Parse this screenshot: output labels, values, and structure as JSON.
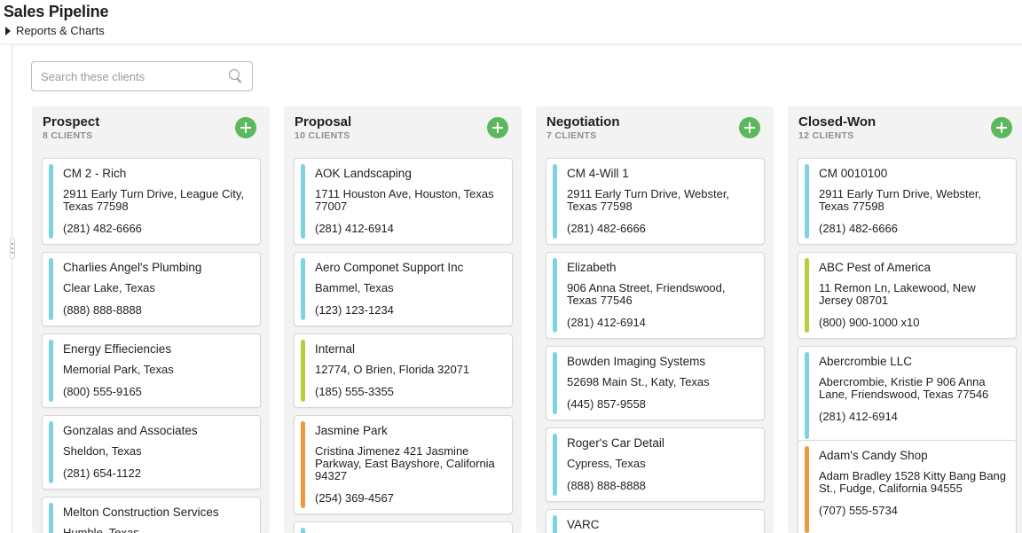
{
  "header": {
    "title": "Sales Pipeline",
    "reports_label": "Reports & Charts"
  },
  "search": {
    "placeholder": "Search these clients"
  },
  "colors": {
    "accent_add": "#5cb85c",
    "bar_blue": "#7dd3e0",
    "bar_green": "#b5cf3c",
    "bar_orange": "#ec9a3c"
  },
  "columns": [
    {
      "title": "Prospect",
      "count": "8 CLIENTS",
      "cards": [
        {
          "name": "CM 2 - Rich",
          "address": "2911 Early Turn Drive, League City, Texas 77598",
          "phone": "(281) 482-6666",
          "color": "blue"
        },
        {
          "name": "Charlies Angel's Plumbing",
          "address": "Clear Lake, Texas",
          "phone": "(888) 888-8888",
          "color": "blue"
        },
        {
          "name": "Energy Effieciencies",
          "address": "Memorial Park, Texas",
          "phone": "(800) 555-9165",
          "color": "blue"
        },
        {
          "name": "Gonzalas and Associates",
          "address": "Sheldon, Texas",
          "phone": "(281) 654-1122",
          "color": "blue"
        },
        {
          "name": "Melton Construction Services",
          "address": "Humble, Texas",
          "phone": "",
          "color": "blue"
        }
      ]
    },
    {
      "title": "Proposal",
      "count": "10 CLIENTS",
      "cards": [
        {
          "name": "AOK Landscaping",
          "address": "1711 Houston Ave, Houston, Texas 77007",
          "phone": "(281) 412-6914",
          "color": "blue"
        },
        {
          "name": "Aero Componet Support Inc",
          "address": "Bammel, Texas",
          "phone": "(123) 123-1234",
          "color": "blue"
        },
        {
          "name": "Internal",
          "address": "12774, O Brien, Florida 32071",
          "phone": "(185) 555-3355",
          "color": "green"
        },
        {
          "name": "Jasmine Park",
          "address": "Cristina Jimenez 421 Jasmine Parkway, East Bayshore, California 94327",
          "phone": "(254) 369-4567",
          "color": "orange"
        },
        {
          "name": "",
          "address": "",
          "phone": "",
          "color": "blue"
        }
      ]
    },
    {
      "title": "Negotiation",
      "count": "7 CLIENTS",
      "cards": [
        {
          "name": "CM 4-Will 1",
          "address": "2911 Early Turn Drive, Webster, Texas 77598",
          "phone": "(281) 482-6666",
          "color": "blue"
        },
        {
          "name": "Elizabeth",
          "address": "906 Anna Street, Friendswood, Texas 77546",
          "phone": "(281) 412-6914",
          "color": "blue"
        },
        {
          "name": "Bowden Imaging Systems",
          "address": "52698 Main St., Katy, Texas",
          "phone": "(445) 857-9558",
          "color": "blue"
        },
        {
          "name": "Roger's Car Detail",
          "address": "Cypress, Texas",
          "phone": "(888) 888-8888",
          "color": "blue"
        },
        {
          "name": "VARC",
          "address": "",
          "phone": "",
          "color": "blue"
        }
      ]
    },
    {
      "title": "Closed-Won",
      "count": "12 CLIENTS",
      "cards": [
        {
          "name": "CM 0010100",
          "address": "2911 Early Turn Drive, Webster, Texas 77598",
          "phone": "(281) 482-6666",
          "color": "blue"
        },
        {
          "name": "ABC Pest of America",
          "address": "11 Remon Ln, Lakewood, New Jersey 08701",
          "phone": "(800) 900-1000 x10",
          "color": "green"
        },
        {
          "name": "Abercrombie LLC",
          "address": "Abercrombie, Kristie P 906 Anna Lane, Friendswood, Texas 77546",
          "phone": "(281) 412-6914",
          "color": "blue"
        },
        {
          "name": "Adam's Candy Shop",
          "address": "Adam Bradley 1528 Kitty Bang Bang St., Fudge, California 94555",
          "phone": "(707) 555-5734",
          "color": "orange"
        }
      ]
    }
  ]
}
